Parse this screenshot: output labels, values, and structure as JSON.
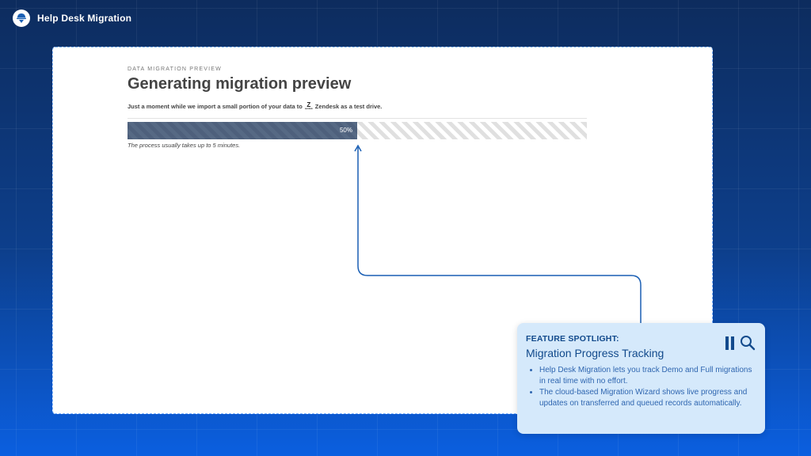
{
  "header": {
    "app_title": "Help Desk Migration",
    "logo_icon": "help-desk-migration-logo-icon"
  },
  "preview": {
    "overline": "DATA MIGRATION PREVIEW",
    "title": "Generating migration preview",
    "subtitle_prefix": "Just a moment while we import a small portion of your data to",
    "zendesk_logo_mark": "Z",
    "zendesk_logo_text": "zendesk",
    "subtitle_suffix": "Zendesk as a test drive.",
    "progress": {
      "percent": 50,
      "label": "50%"
    },
    "note": "The process usually takes up to 5 minutes."
  },
  "spotlight": {
    "overline": "FEATURE SPOTLIGHT:",
    "title": "Migration Progress Tracking",
    "bullets": [
      "Help Desk Migration lets you track Demo and Full migrations in real time with no effort.",
      "The cloud-based Migration Wizard shows live progress and updates on transferred and queued records automatically."
    ],
    "controls": [
      "pause-icon",
      "search-icon"
    ]
  },
  "colors": {
    "background_top": "#0d2c5e",
    "background_bottom": "#0b5fe0",
    "progress_fill": "#4e607c",
    "card_background": "#d5e9fb",
    "card_text": "#124a8c",
    "connector": "#1a5fb4"
  }
}
